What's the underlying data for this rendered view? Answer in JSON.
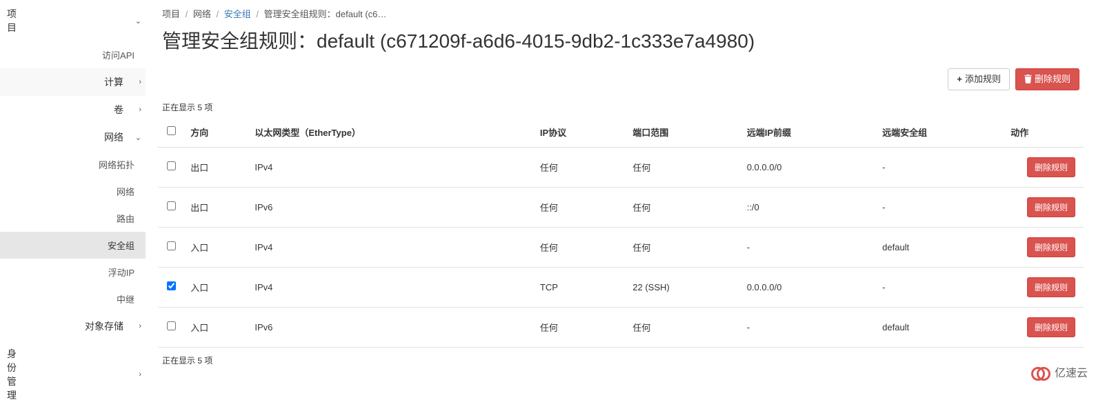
{
  "sidebar": {
    "project": "项目",
    "api": "访问API",
    "compute": "计算",
    "volumes": "卷",
    "network": "网络",
    "network_sub": {
      "topology": "网络拓扑",
      "networks": "网络",
      "routers": "路由",
      "security_groups": "安全组",
      "floating_ips": "浮动IP",
      "trunks": "中继"
    },
    "object_storage": "对象存储",
    "identity": "身份管理"
  },
  "breadcrumb": {
    "project": "项目",
    "network": "网络",
    "security_groups": "安全组",
    "current": "管理安全组规则：default (c6…"
  },
  "title": "管理安全组规则：default (c671209f-a6d6-4015-9db2-1c333e7a4980)",
  "toolbar": {
    "add_rule": "添加规则",
    "delete_rules": "删除规则"
  },
  "table": {
    "caption_top": "正在显示 5 项",
    "caption_bottom": "正在显示 5 项",
    "headers": {
      "direction": "方向",
      "ethertype": "以太网类型（EtherType）",
      "protocol": "IP协议",
      "port_range": "端口范围",
      "remote_ip": "远端IP前缀",
      "remote_sg": "远端安全组",
      "actions": "动作"
    },
    "delete_label": "删除规则",
    "rows": [
      {
        "checked": false,
        "direction": "出口",
        "ethertype": "IPv4",
        "protocol": "任何",
        "port_range": "任何",
        "remote_ip": "0.0.0.0/0",
        "remote_sg": "-"
      },
      {
        "checked": false,
        "direction": "出口",
        "ethertype": "IPv6",
        "protocol": "任何",
        "port_range": "任何",
        "remote_ip": "::/0",
        "remote_sg": "-"
      },
      {
        "checked": false,
        "direction": "入口",
        "ethertype": "IPv4",
        "protocol": "任何",
        "port_range": "任何",
        "remote_ip": "-",
        "remote_sg": "default"
      },
      {
        "checked": true,
        "direction": "入口",
        "ethertype": "IPv4",
        "protocol": "TCP",
        "port_range": "22 (SSH)",
        "remote_ip": "0.0.0.0/0",
        "remote_sg": "-"
      },
      {
        "checked": false,
        "direction": "入口",
        "ethertype": "IPv6",
        "protocol": "任何",
        "port_range": "任何",
        "remote_ip": "-",
        "remote_sg": "default"
      }
    ]
  },
  "logo_text": "亿速云"
}
